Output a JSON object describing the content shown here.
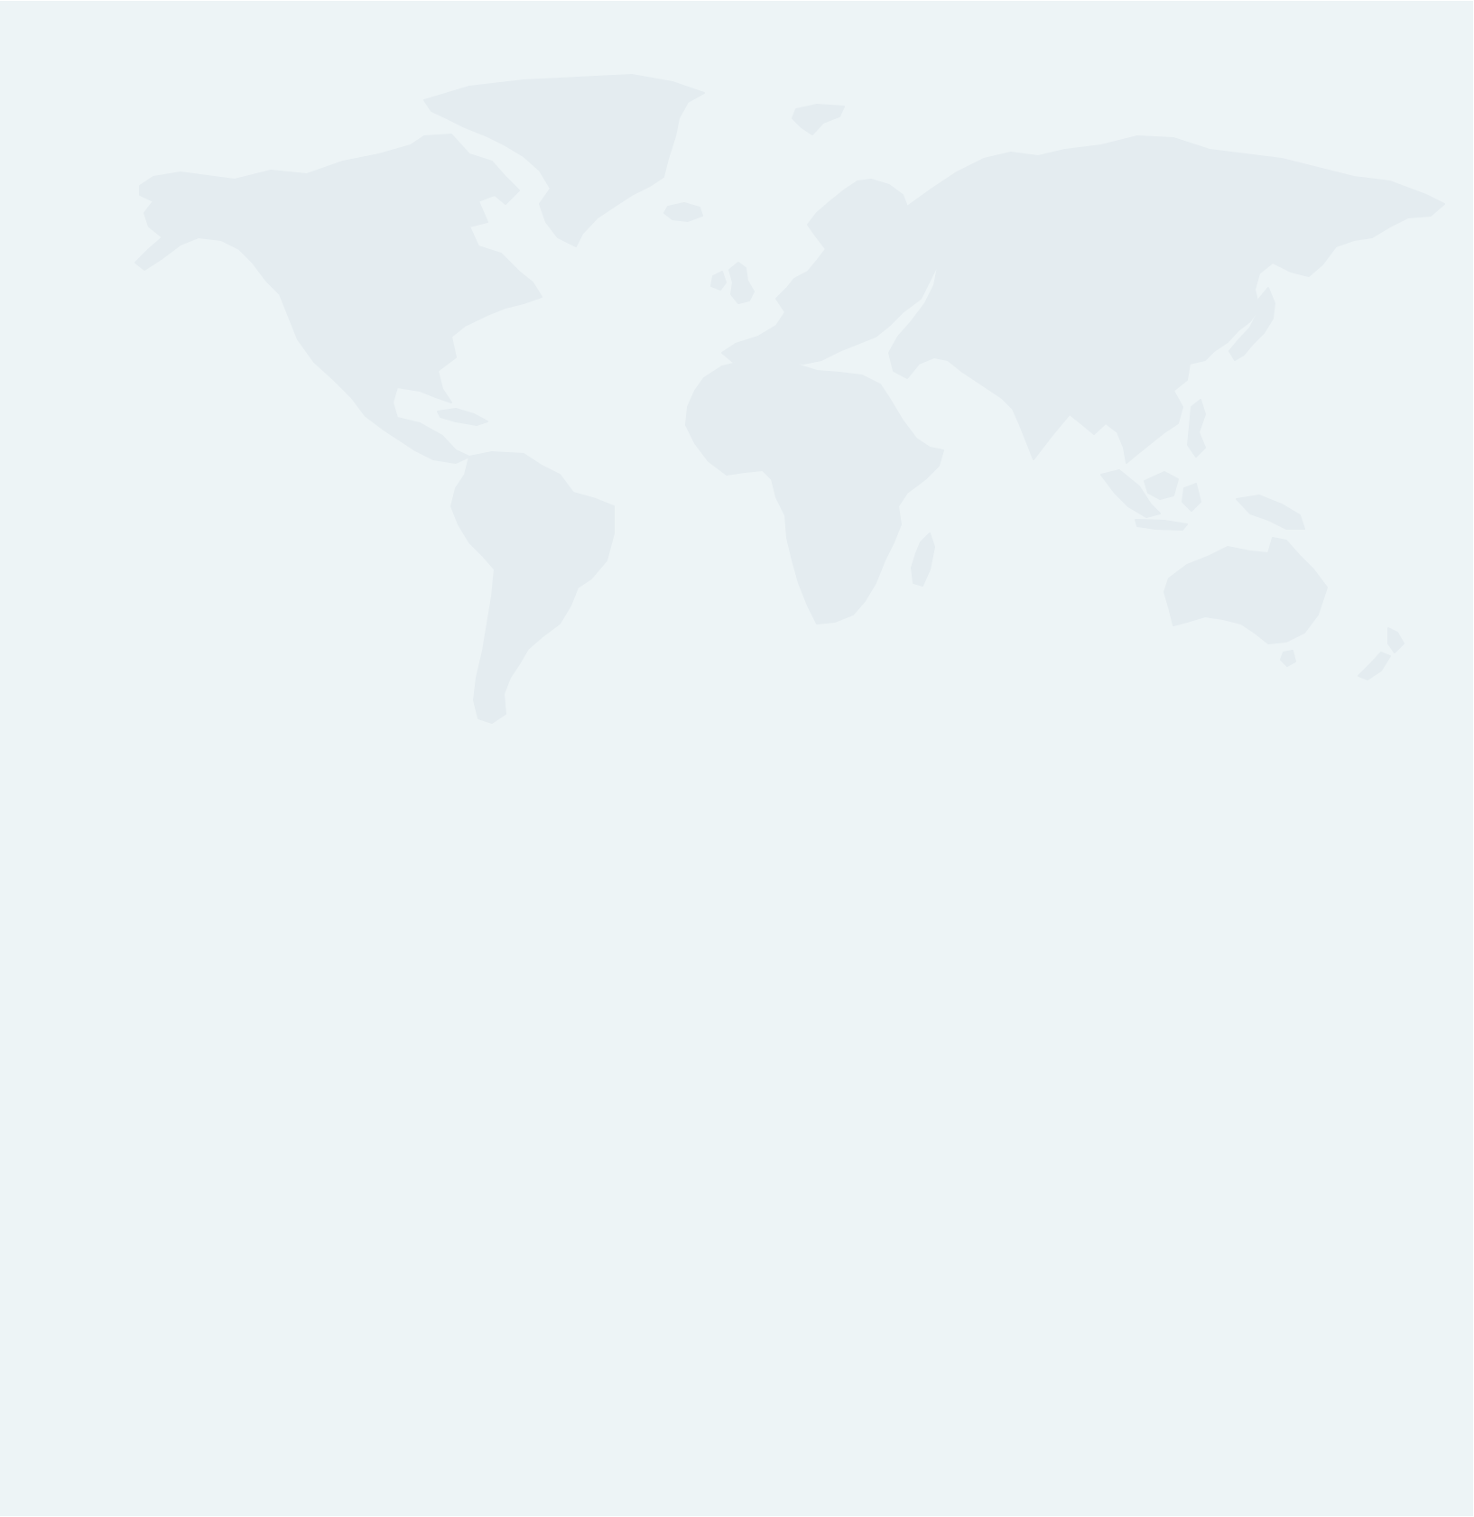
{
  "map": {
    "colors": {
      "background": "#edf4f6",
      "land": "#e4ecf0"
    },
    "landmasses": [
      "north-america",
      "greenland",
      "iceland",
      "south-america",
      "europe",
      "great-britain",
      "africa",
      "madagascar",
      "asia",
      "japan",
      "indonesia",
      "philippines",
      "new-guinea",
      "australia",
      "new-zealand",
      "svalbard",
      "cuba"
    ]
  }
}
